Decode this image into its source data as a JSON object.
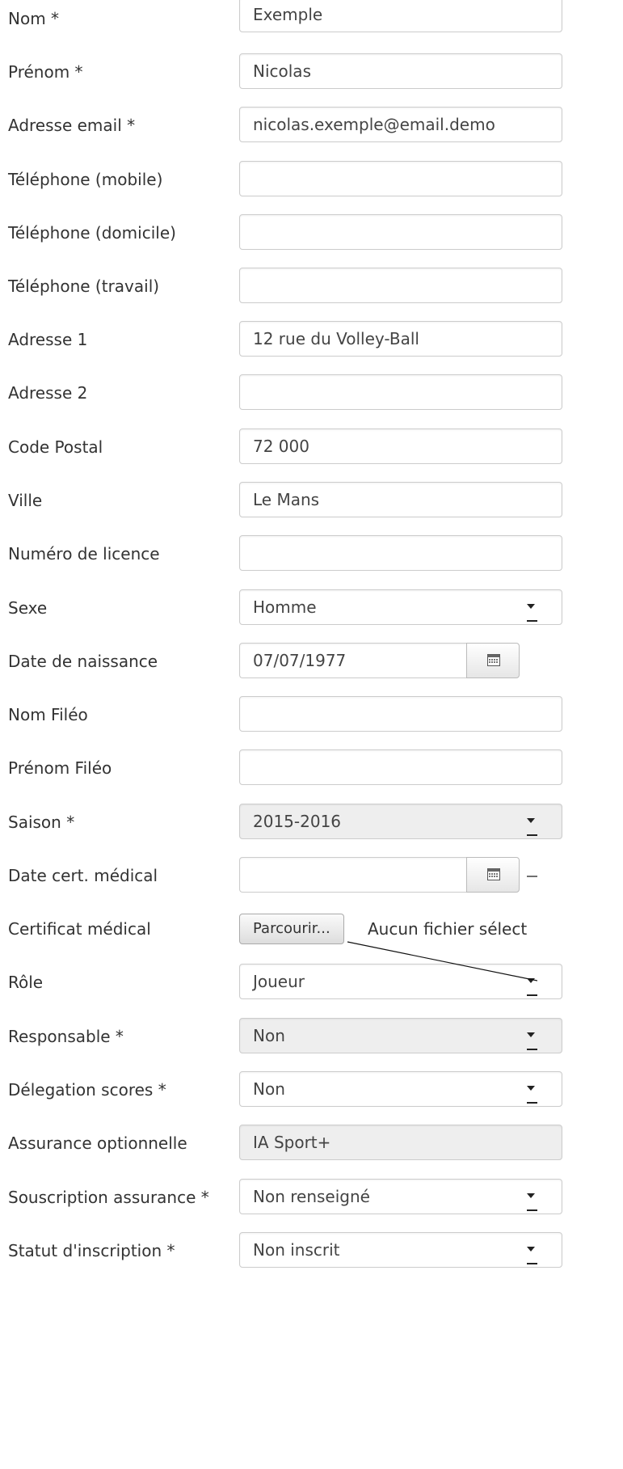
{
  "fields": {
    "nom": {
      "label": "Nom *",
      "value": "Exemple"
    },
    "prenom": {
      "label": "Prénom *",
      "value": "Nicolas"
    },
    "email": {
      "label": "Adresse email *",
      "value": "nicolas.exemple@email.demo"
    },
    "tel_mobile": {
      "label": "Téléphone (mobile)",
      "value": ""
    },
    "tel_domicile": {
      "label": "Téléphone (domicile)",
      "value": ""
    },
    "tel_travail": {
      "label": "Téléphone (travail)",
      "value": ""
    },
    "adresse1": {
      "label": "Adresse 1",
      "value": "12 rue du Volley-Ball"
    },
    "adresse2": {
      "label": "Adresse 2",
      "value": ""
    },
    "code_postal": {
      "label": "Code Postal",
      "value": "72 000"
    },
    "ville": {
      "label": "Ville",
      "value": "Le Mans"
    },
    "licence": {
      "label": "Numéro de licence",
      "value": ""
    },
    "sexe": {
      "label": "Sexe",
      "value": "Homme"
    },
    "date_naissance": {
      "label": "Date de naissance",
      "value": "07/07/1977"
    },
    "nom_fileo": {
      "label": "Nom Filéo",
      "value": ""
    },
    "prenom_fileo": {
      "label": "Prénom Filéo",
      "value": ""
    },
    "saison": {
      "label": "Saison *",
      "value": "2015-2016"
    },
    "date_cert": {
      "label": "Date cert. médical",
      "value": ""
    },
    "certificat": {
      "label": "Certificat médical",
      "button": "Parcourir...",
      "status": "Aucun fichier sélect"
    },
    "role": {
      "label": "Rôle",
      "value": "Joueur"
    },
    "responsable": {
      "label": "Responsable *",
      "value": "Non"
    },
    "delegation": {
      "label": "Délegation scores *",
      "value": "Non"
    },
    "assurance_opt": {
      "label": "Assurance optionnelle",
      "value": "IA Sport+"
    },
    "souscription": {
      "label": "Souscription assurance *",
      "value": "Non renseigné"
    },
    "statut": {
      "label": "Statut d'inscription *",
      "value": "Non inscrit"
    }
  },
  "icons": {
    "calendar": "calendar-icon",
    "select_arrow": "chevron-down-icon"
  }
}
